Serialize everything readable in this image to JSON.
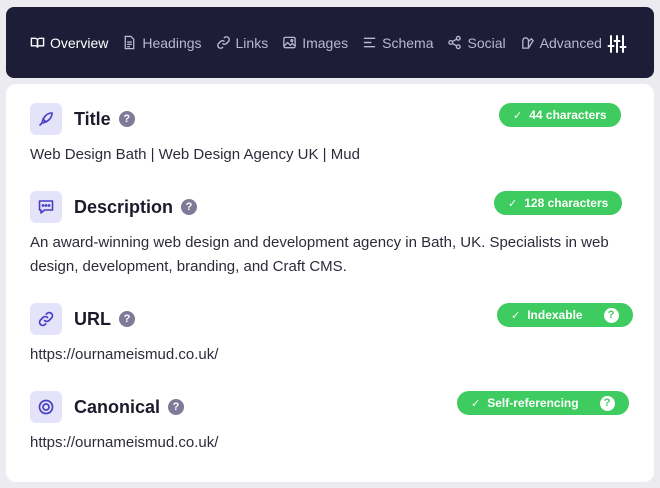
{
  "nav": {
    "tabs": [
      {
        "label": "Overview",
        "icon": "book-open-icon",
        "active": true
      },
      {
        "label": "Headings",
        "icon": "document-icon"
      },
      {
        "label": "Links",
        "icon": "link-icon"
      },
      {
        "label": "Images",
        "icon": "image-icon"
      },
      {
        "label": "Schema",
        "icon": "list-icon"
      },
      {
        "label": "Social",
        "icon": "share-icon"
      },
      {
        "label": "Advanced",
        "icon": "advanced-icon"
      }
    ],
    "settings_icon": "sliders-icon"
  },
  "colors": {
    "nav_bg": "#1e1d38",
    "accent": "#4a3fc4",
    "icon_bg": "#e4e3f9",
    "badge_green": "#3ecb5f"
  },
  "fields": {
    "title": {
      "label": "Title",
      "icon": "pen-icon",
      "badge": "44 characters",
      "value": "Web Design Bath | Web Design Agency UK | Mud"
    },
    "description": {
      "label": "Description",
      "icon": "chat-icon",
      "badge": "128 characters",
      "value": "An award-winning web design and development agency in Bath, UK. Specialists in web design, development, branding, and Craft CMS."
    },
    "url": {
      "label": "URL",
      "icon": "link-icon",
      "badge": "Indexable",
      "value": "https://ournameismud.co.uk/"
    },
    "canonical": {
      "label": "Canonical",
      "icon": "target-icon",
      "badge": "Self-referencing",
      "value": "https://ournameismud.co.uk/"
    }
  },
  "help_glyph": "?",
  "check_glyph": "✓"
}
